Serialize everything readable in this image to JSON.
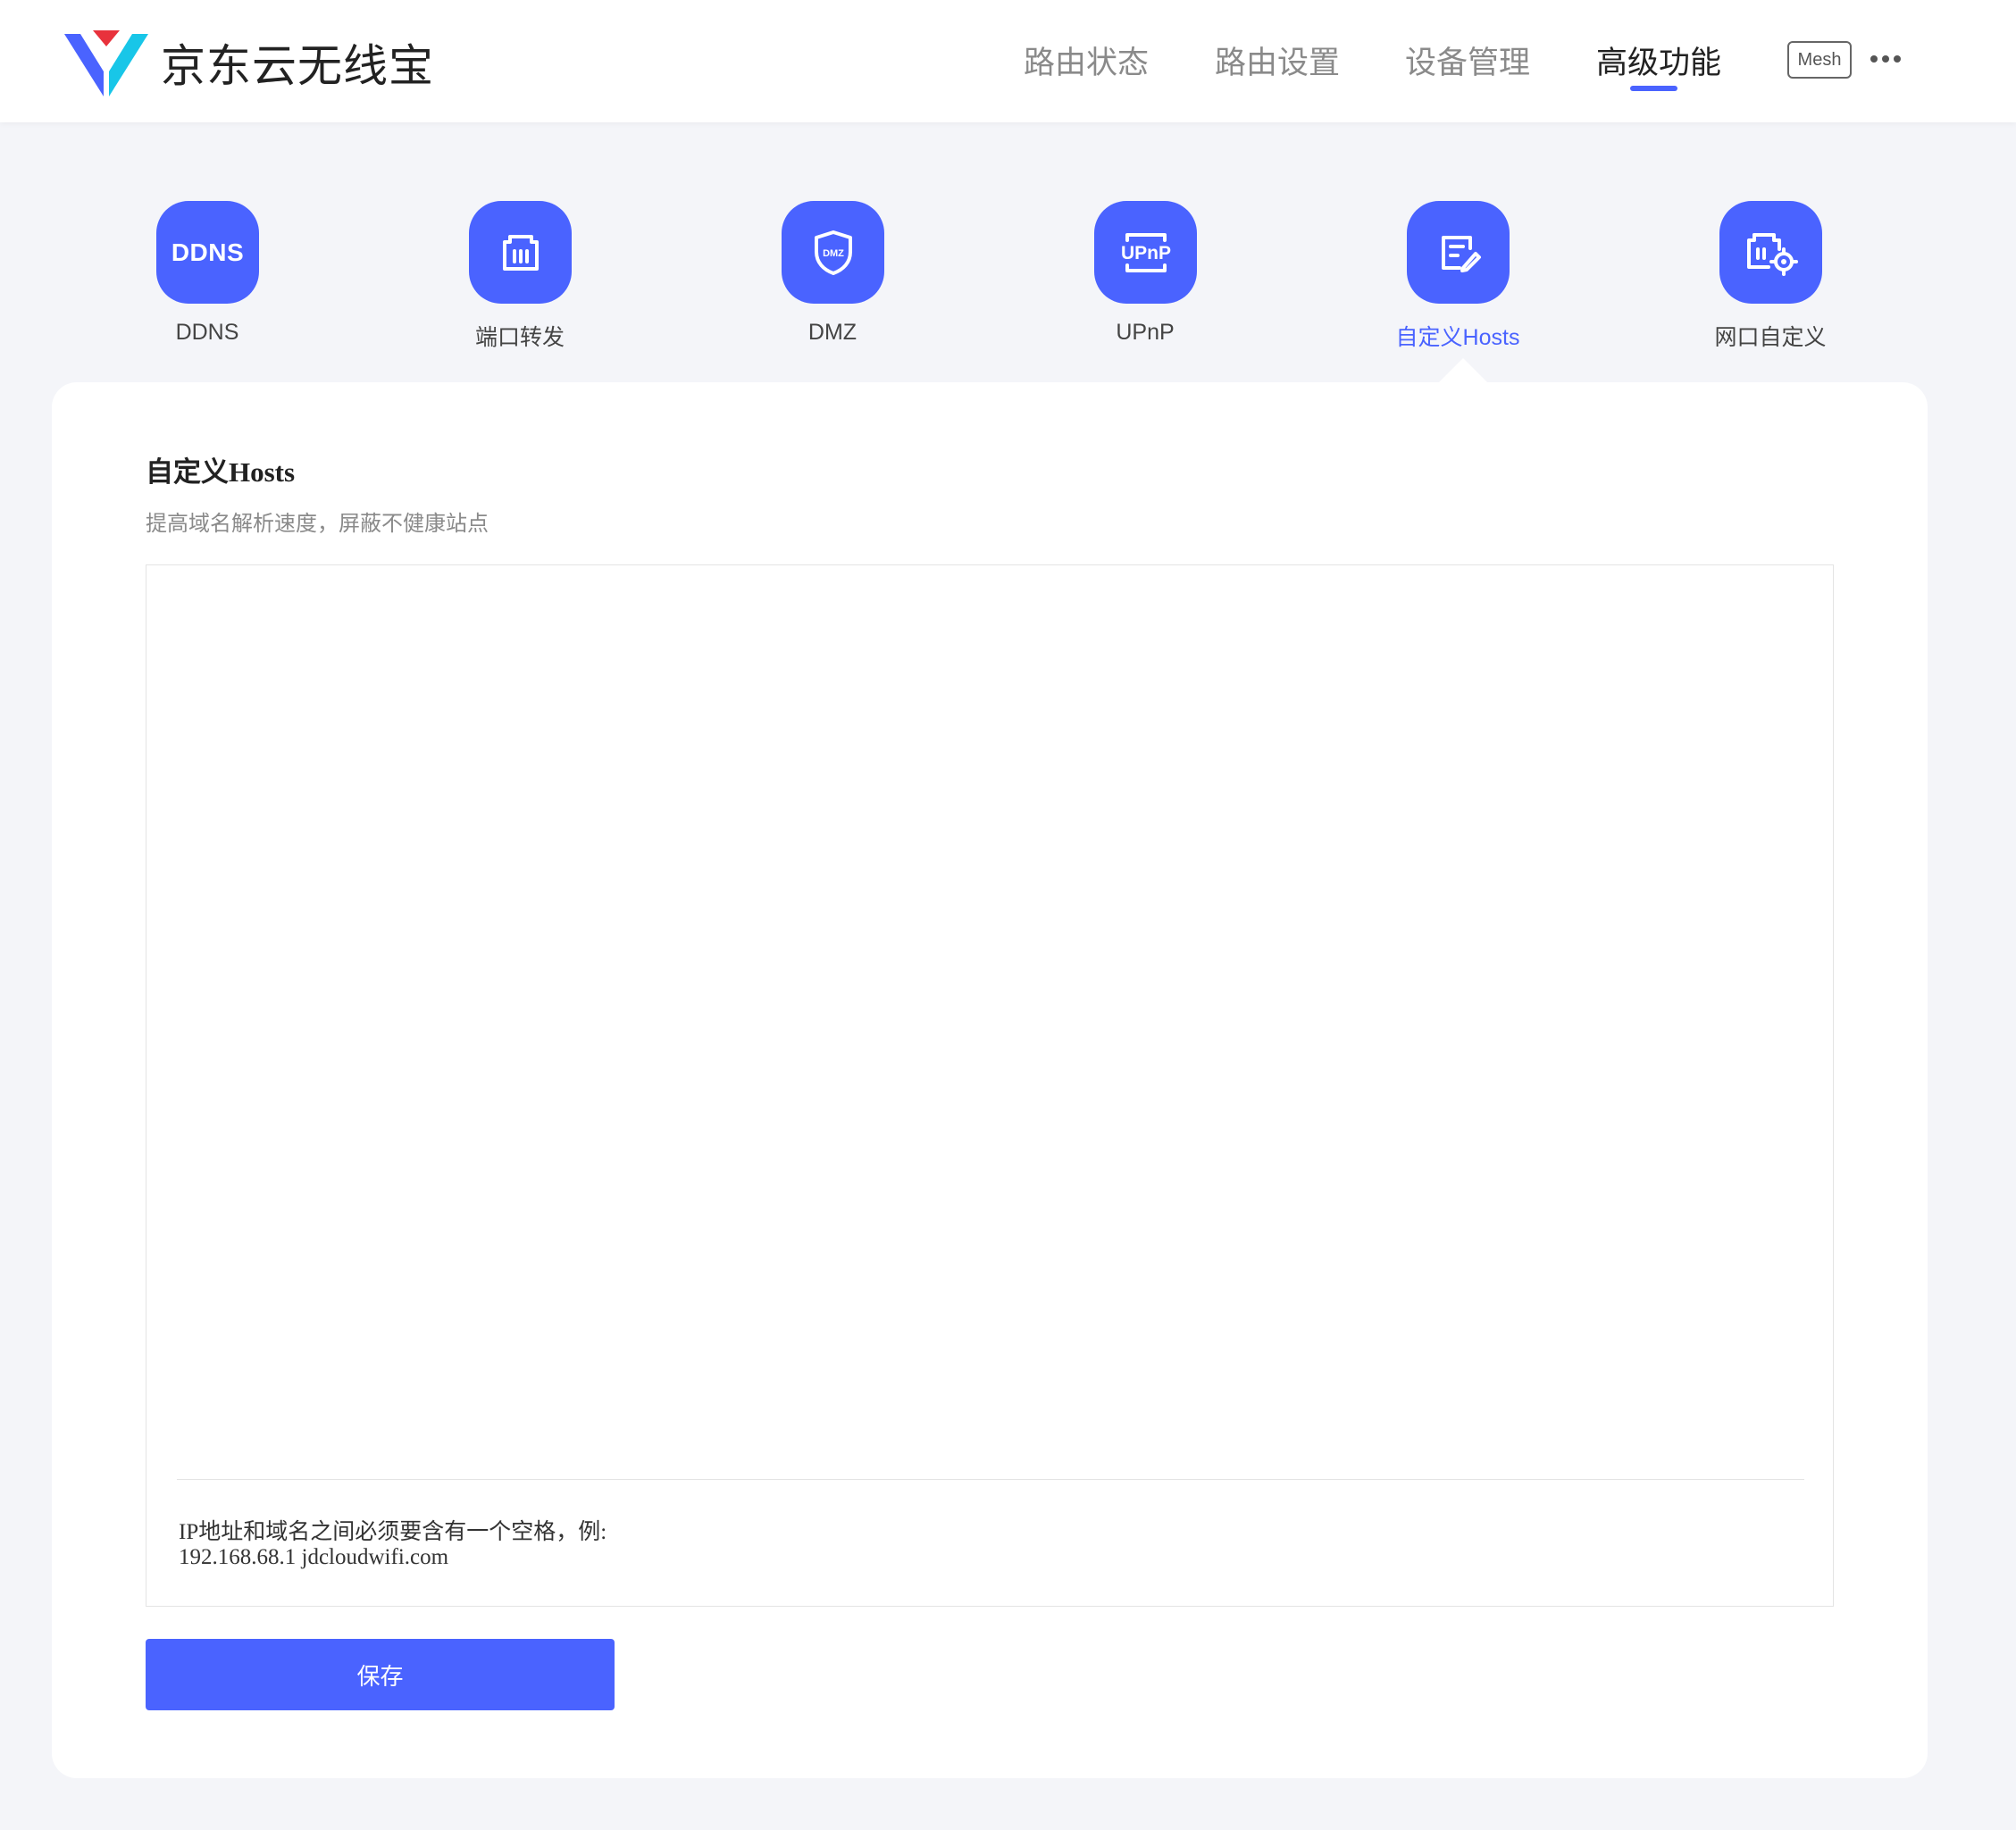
{
  "brand": {
    "name": "京东云无线宝",
    "logo": "jdcloud-logo"
  },
  "nav": {
    "items": [
      {
        "label": "路由状态",
        "active": false
      },
      {
        "label": "路由设置",
        "active": false
      },
      {
        "label": "设备管理",
        "active": false
      },
      {
        "label": "高级功能",
        "active": true
      }
    ],
    "mesh_label": "Mesh",
    "more_icon": "more-dots-icon"
  },
  "features": [
    {
      "label": "DDNS",
      "icon": "ddns-icon",
      "icon_text": "DDNS",
      "active": false
    },
    {
      "label": "端口转发",
      "icon": "port-forward-icon",
      "active": false
    },
    {
      "label": "DMZ",
      "icon": "dmz-shield-icon",
      "icon_text": "DMZ",
      "active": false
    },
    {
      "label": "UPnP",
      "icon": "upnp-icon",
      "icon_text": "UPnP",
      "active": false
    },
    {
      "label": "自定义Hosts",
      "icon": "edit-hosts-icon",
      "active": true
    },
    {
      "label": "网口自定义",
      "icon": "port-settings-icon",
      "active": false
    }
  ],
  "section": {
    "title": "自定义Hosts",
    "subtitle": "提高域名解析速度，屏蔽不健康站点",
    "hosts_value": "",
    "hint_line1": "IP地址和域名之间必须要含有一个空格，例:",
    "hint_line2": "192.168.68.1 jdcloudwifi.com",
    "save_label": "保存"
  },
  "colors": {
    "accent": "#4a63ff",
    "background": "#f4f5f9",
    "logo_red": "#e8323c",
    "logo_cyan": "#18c6e8"
  }
}
